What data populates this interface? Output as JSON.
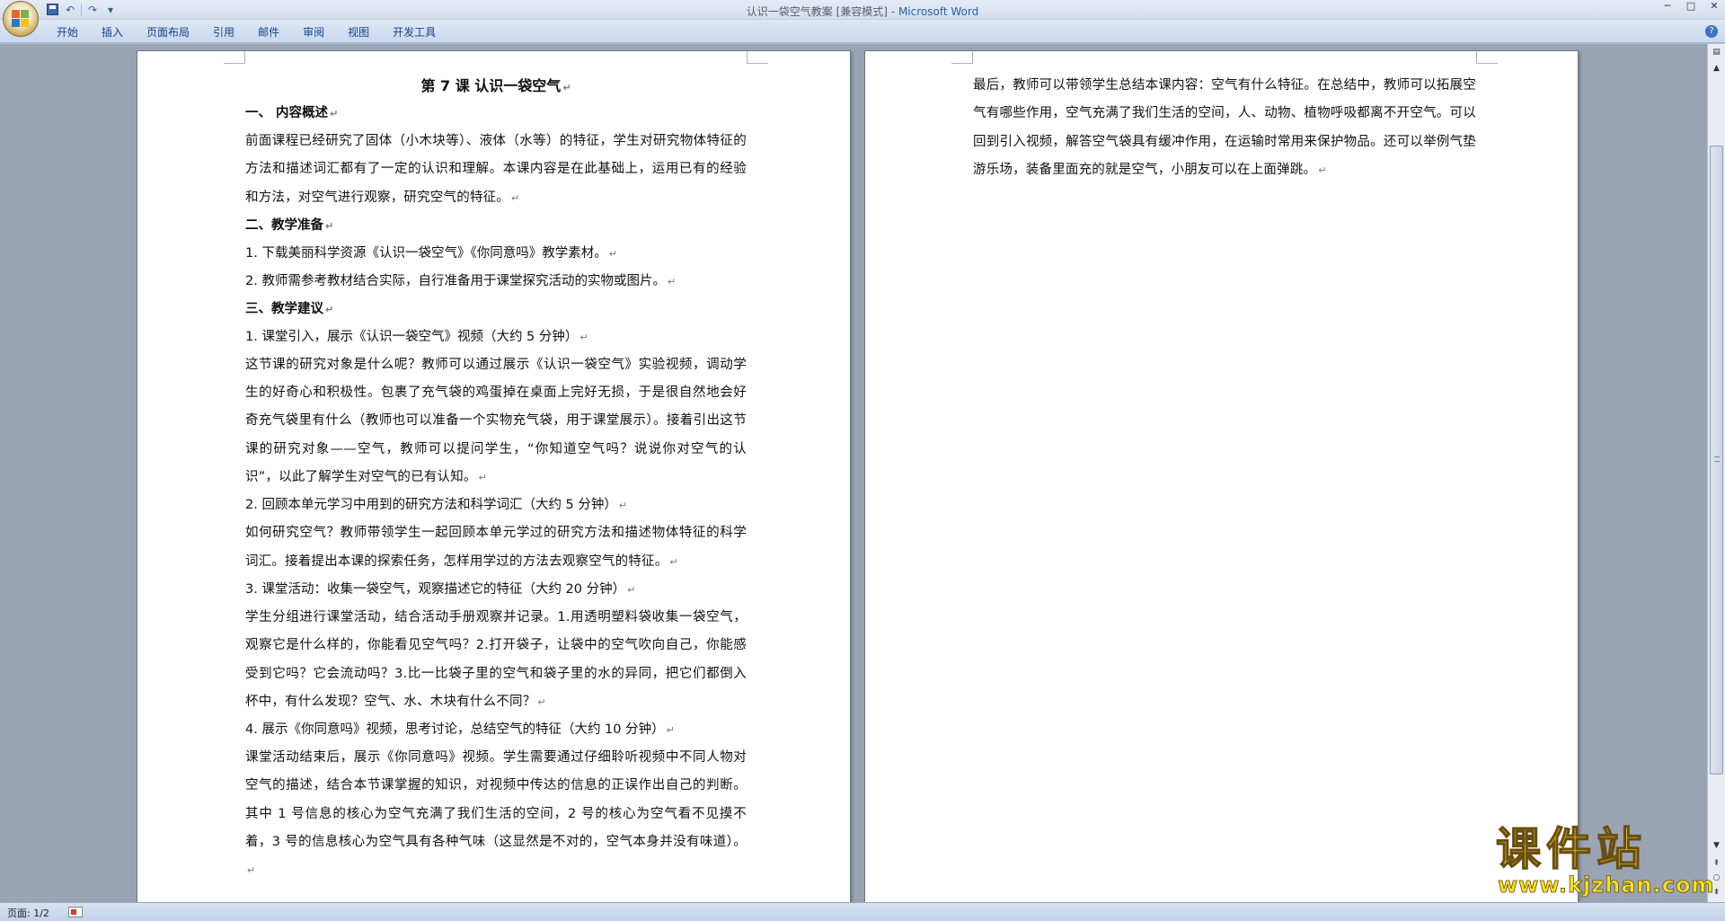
{
  "window": {
    "title": "认识一袋空气教案 [兼容模式]",
    "separator": " - ",
    "app": "Microsoft Word",
    "controls": [
      "─",
      "□",
      "✕"
    ]
  },
  "ribbon": {
    "tabs": [
      "开始",
      "插入",
      "页面布局",
      "引用",
      "邮件",
      "审阅",
      "视图",
      "开发工具"
    ],
    "help": "?"
  },
  "qat": {
    "undo": "↶",
    "redo": "↷",
    "customize": "▾"
  },
  "document": {
    "title": "第 7 课  认识一袋空气",
    "sec1_heading": "一、     内容概述",
    "sec1_para": "前面课程已经研究了固体（小木块等）、液体（水等）的特征，学生对研究物体特征的方法和描述词汇都有了一定的认识和理解。本课内容是在此基础上，运用已有的经验和方法，对空气进行观察，研究空气的特征。",
    "sec2_heading": "二、教学准备",
    "prep_1": "1.   下载美丽科学资源《认识一袋空气》《你同意吗》教学素材。",
    "prep_2": "2.   教师需参考教材结合实际，自行准备用于课堂探究活动的实物或图片。",
    "sec3_heading": "三、教学建议",
    "step1_title": "1.   课堂引入，展示《认识一袋空气》视频（大约 5 分钟）",
    "step1_para": "这节课的研究对象是什么呢？教师可以通过展示《认识一袋空气》实验视频，调动学生的好奇心和积极性。包裹了充气袋的鸡蛋掉在桌面上完好无损，于是很自然地会好奇充气袋里有什么（教师也可以准备一个实物充气袋，用于课堂展示）。接着引出这节课的研究对象——空气，教师可以提问学生，“你知道空气吗？说说你对空气的认识”，以此了解学生对空气的已有认知。",
    "step2_title": "2.   回顾本单元学习中用到的研究方法和科学词汇（大约 5 分钟）",
    "step2_para": "如何研究空气？教师带领学生一起回顾本单元学过的研究方法和描述物体特征的科学词汇。接着提出本课的探索任务，怎样用学过的方法去观察空气的特征。",
    "step3_title": "3.   课堂活动：收集一袋空气，观察描述它的特征（大约 20 分钟）",
    "step3_para": "学生分组进行课堂活动，结合活动手册观察并记录。1.用透明塑料袋收集一袋空气，观察它是什么样的，你能看见空气吗？2.打开袋子，让袋中的空气吹向自己，你能感受到它吗？它会流动吗？3.比一比袋子里的空气和袋子里的水的异同，把它们都倒入杯中，有什么发现？空气、水、木块有什么不同？",
    "step4_title": "4.   展示《你同意吗》视频，思考讨论，总结空气的特征（大约 10 分钟）",
    "step4_para": "课堂活动结束后，展示《你同意吗》视频。学生需要通过仔细聆听视频中不同人物对空气的描述，结合本节课掌握的知识，对视频中传达的信息的正误作出自己的判断。其中 1 号信息的核心为空气充满了我们生活的空间，2 号的核心为空气看不见摸不着，3 号的信息核心为空气具有各种气味（这显然是不对的，空气本身并没有味道）。",
    "page2_para": "最后，教师可以带领学生总结本课内容：空气有什么特征。在总结中，教师可以拓展空气有哪些作用，空气充满了我们生活的空间，人、动物、植物呼吸都离不开空气。可以回到引入视频，解答空气袋具有缓冲作用，在运输时常用来保护物品。还可以举例气垫游乐场，装备里面充的就是空气，小朋友可以在上面弹跳。",
    "para_mark": "↵"
  },
  "status": {
    "pages": "页面: 1/2"
  },
  "watermark": {
    "title": "课件站",
    "url": "www.kjzhan.com"
  }
}
